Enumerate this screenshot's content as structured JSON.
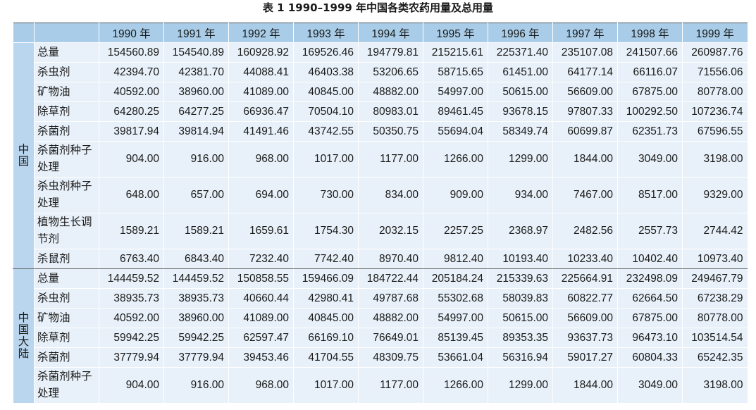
{
  "title": "表 1  1990–1999 年中国各类农药用量及总用量",
  "years": [
    "1990 年",
    "1991 年",
    "1992 年",
    "1993 年",
    "1994 年",
    "1995 年",
    "1996 年",
    "1997 年",
    "1998 年",
    "1999 年"
  ],
  "groups": [
    {
      "label": "中国",
      "rows": [
        {
          "category": "总量",
          "values": [
            "154560.89",
            "154540.89",
            "160928.92",
            "169526.46",
            "194779.81",
            "215215.61",
            "225371.40",
            "235107.08",
            "241507.66",
            "260987.76"
          ]
        },
        {
          "category": "杀虫剂",
          "values": [
            "42394.70",
            "42381.70",
            "44088.41",
            "46403.38",
            "53206.65",
            "58715.65",
            "61451.00",
            "64177.14",
            "66116.07",
            "71556.06"
          ]
        },
        {
          "category": "矿物油",
          "values": [
            "40592.00",
            "38960.00",
            "41089.00",
            "40845.00",
            "48882.00",
            "54997.00",
            "50615.00",
            "56609.00",
            "67875.00",
            "80778.00"
          ]
        },
        {
          "category": "除草剂",
          "values": [
            "64280.25",
            "64277.25",
            "66936.47",
            "70504.10",
            "80983.01",
            "89461.45",
            "93678.15",
            "97807.33",
            "100292.50",
            "107236.74"
          ]
        },
        {
          "category": "杀菌剂",
          "values": [
            "39817.94",
            "39814.94",
            "41491.46",
            "43742.55",
            "50350.75",
            "55694.04",
            "58349.74",
            "60699.87",
            "62351.73",
            "67596.55"
          ]
        },
        {
          "category": "杀菌剂种子处理",
          "values": [
            "904.00",
            "916.00",
            "968.00",
            "1017.00",
            "1177.00",
            "1266.00",
            "1299.00",
            "1844.00",
            "3049.00",
            "3198.00"
          ]
        },
        {
          "category": "杀虫剂种子处理",
          "values": [
            "648.00",
            "657.00",
            "694.00",
            "730.00",
            "834.00",
            "909.00",
            "934.00",
            "7467.00",
            "8517.00",
            "9329.00"
          ]
        },
        {
          "category": "植物生长调节剂",
          "values": [
            "1589.21",
            "1589.21",
            "1659.61",
            "1754.30",
            "2032.15",
            "2257.25",
            "2368.97",
            "2482.56",
            "2557.73",
            "2744.42"
          ]
        },
        {
          "category": "杀鼠剂",
          "values": [
            "6763.40",
            "6843.40",
            "7232.40",
            "7742.40",
            "8970.40",
            "9812.40",
            "10193.40",
            "10233.40",
            "10402.40",
            "10973.40"
          ]
        }
      ]
    },
    {
      "label": "中国大陆",
      "rows": [
        {
          "category": "总量",
          "values": [
            "144459.52",
            "144459.52",
            "150858.55",
            "159466.09",
            "184722.44",
            "205184.24",
            "215339.63",
            "225664.91",
            "232498.09",
            "249467.79"
          ]
        },
        {
          "category": "杀虫剂",
          "values": [
            "38935.73",
            "38935.73",
            "40660.44",
            "42980.41",
            "49787.68",
            "55302.68",
            "58039.83",
            "60822.77",
            "62664.50",
            "67238.29"
          ]
        },
        {
          "category": "矿物油",
          "values": [
            "40592.00",
            "38960.00",
            "41089.00",
            "40845.00",
            "48882.00",
            "54997.00",
            "50615.00",
            "56609.00",
            "67875.00",
            "80778.00"
          ]
        },
        {
          "category": "除草剂",
          "values": [
            "59942.25",
            "59942.25",
            "62597.47",
            "66169.10",
            "76649.01",
            "85139.45",
            "89353.35",
            "93637.73",
            "96473.10",
            "103514.54"
          ]
        },
        {
          "category": "杀菌剂",
          "values": [
            "37779.94",
            "37779.94",
            "39453.46",
            "41704.55",
            "48309.75",
            "53661.04",
            "56316.94",
            "59017.27",
            "60804.33",
            "65242.35"
          ]
        },
        {
          "category": "杀菌剂种子处理",
          "values": [
            "904.00",
            "916.00",
            "968.00",
            "1017.00",
            "1177.00",
            "1266.00",
            "1299.00",
            "1844.00",
            "3049.00",
            "3198.00"
          ]
        }
      ]
    }
  ],
  "colors": {
    "header_bg": "#a9cde8",
    "group_bg": "#b9d6ee",
    "cell_bg": "#e8f1f9"
  }
}
